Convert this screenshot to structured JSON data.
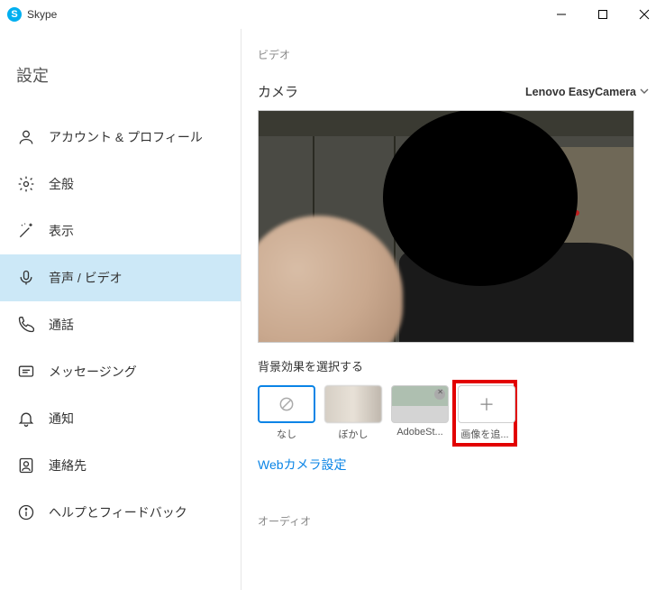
{
  "titlebar": {
    "app": "Skype"
  },
  "sidebar": {
    "title": "設定",
    "items": [
      {
        "label": "アカウント & プロフィール",
        "icon": "account-icon"
      },
      {
        "label": "全般",
        "icon": "gear-icon"
      },
      {
        "label": "表示",
        "icon": "wand-icon"
      },
      {
        "label": "音声 / ビデオ",
        "icon": "mic-icon",
        "selected": true
      },
      {
        "label": "通話",
        "icon": "phone-icon"
      },
      {
        "label": "メッセージング",
        "icon": "message-icon"
      },
      {
        "label": "通知",
        "icon": "bell-icon"
      },
      {
        "label": "連絡先",
        "icon": "contacts-icon"
      },
      {
        "label": "ヘルプとフィードバック",
        "icon": "info-icon"
      }
    ]
  },
  "main": {
    "video_section": "ビデオ",
    "camera_label": "カメラ",
    "camera_value": "Lenovo EasyCamera",
    "background_label": "背景効果を選択する",
    "bg_options": {
      "none": "なし",
      "blur": "ぼかし",
      "adobe": "AdobeSt...",
      "add": "画像を追..."
    },
    "webcam_link": "Webカメラ設定",
    "audio_section": "オーディオ"
  }
}
